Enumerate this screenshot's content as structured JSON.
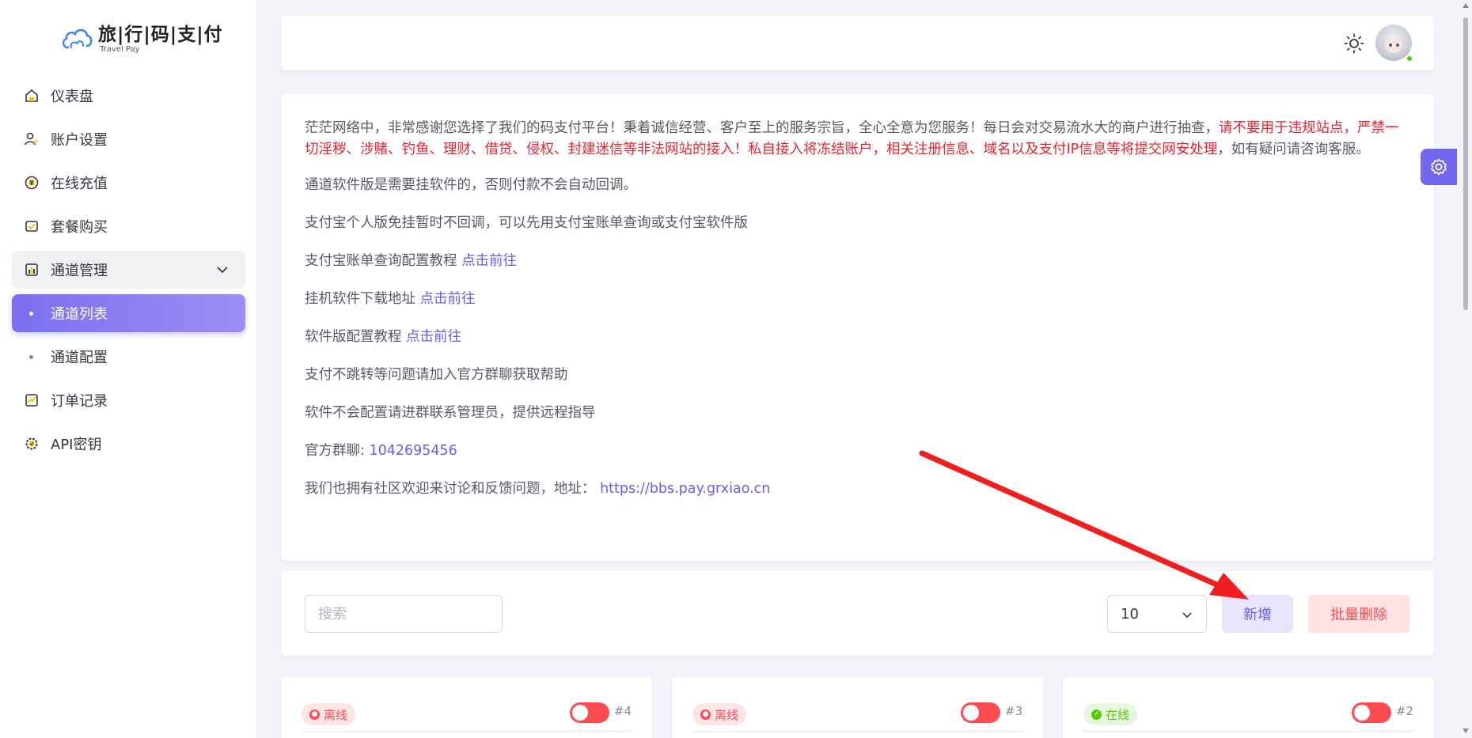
{
  "brand": {
    "title": "旅|行|码|支|付",
    "subtitle": "Travel Pay"
  },
  "sidebar": {
    "items": [
      {
        "label": "仪表盘",
        "icon": "home-icon"
      },
      {
        "label": "账户设置",
        "icon": "user-edit-icon"
      },
      {
        "label": "在线充值",
        "icon": "yen-coin-icon"
      },
      {
        "label": "套餐购买",
        "icon": "wallet-icon"
      },
      {
        "label": "通道管理",
        "icon": "bar-chart-icon"
      },
      {
        "label": "通道列表"
      },
      {
        "label": "通道配置"
      },
      {
        "label": "订单记录",
        "icon": "trend-chart-icon"
      },
      {
        "label": "API密钥",
        "icon": "gear-check-icon"
      }
    ]
  },
  "notice": {
    "intro_normal": "茫茫网络中，非常感谢您选择了我们的码支付平台！秉着诚信经营、客户至上的服务宗旨，全心全意为您服务！每日会对交易流水大的商户进行抽查，",
    "intro_red": "请不要用于违规站点，严禁一切淫秽、涉赌、钓鱼、理财、借贷、侵权、封建迷信等非法网站的接入！私自接入将冻结账户，相关注册信息、域名以及支付IP信息等将提交网安处理",
    "intro_tail": "，如有疑问请咨询客服。",
    "line_software": "通道软件版是需要挂软件的，否则付款不会自动回调。",
    "line_alipay": "支付宝个人版免挂暂时不回调，可以先用支付宝账单查询或支付宝软件版",
    "line_tutorial1_text": "支付宝账单查询配置教程 ",
    "line_tutorial1_link": "点击前往",
    "line_download_text": "挂机软件下载地址 ",
    "line_download_link": "点击前往",
    "line_tutorial2_text": "软件版配置教程 ",
    "line_tutorial2_link": "点击前往",
    "line_help": "支付不跳转等问题请加入官方群聊获取帮助",
    "line_config": "软件不会配置请进群联系管理员，提供远程指导",
    "line_group_text": "官方群聊: ",
    "line_group_link": "1042695456",
    "line_forum_text": "我们也拥有社区欢迎来讨论和反馈问题，地址： ",
    "line_forum_link": "https://bbs.pay.grxiao.cn"
  },
  "toolbar": {
    "search_placeholder": "搜索",
    "page_size": "10",
    "add_label": "新增",
    "batch_delete_label": "批量删除"
  },
  "channels": [
    {
      "status": "离线",
      "state": "offline",
      "id": "#4"
    },
    {
      "status": "离线",
      "state": "offline",
      "id": "#3"
    },
    {
      "status": "在线",
      "state": "online",
      "id": "#2"
    }
  ],
  "colors": {
    "primary": "#7367f0",
    "danger": "#ff4c51",
    "success": "#56ca00",
    "annotation_arrow": "#f01f1f"
  }
}
